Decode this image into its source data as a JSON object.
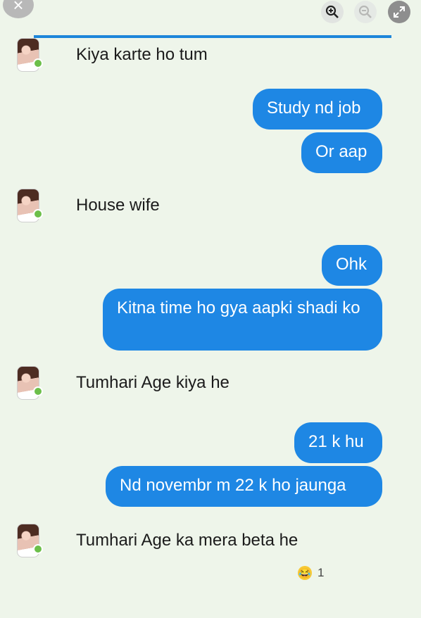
{
  "toolbar": {
    "close_icon": "×",
    "zoom_in_icon": "zoom-in-icon",
    "zoom_out_icon": "zoom-out-icon",
    "expand_icon": "expand-icon"
  },
  "colors": {
    "accent": "#1e87e4",
    "background": "#eef5ea",
    "online": "#6cbf4a"
  },
  "messages": {
    "m1": "Kiya karte ho tum",
    "m2": "Study nd job",
    "m3": "Or aap",
    "m4": "House wife",
    "m5": "Ohk",
    "m6": "Kitna time ho gya aapki shadi ko",
    "m7": "Tumhari Age kiya he",
    "m8": "21 k hu",
    "m9": "Nd novembr m 22 k ho jaunga",
    "m10": "Tumhari Age ka mera beta he"
  },
  "reaction": {
    "emoji": "😂",
    "count": "1"
  }
}
